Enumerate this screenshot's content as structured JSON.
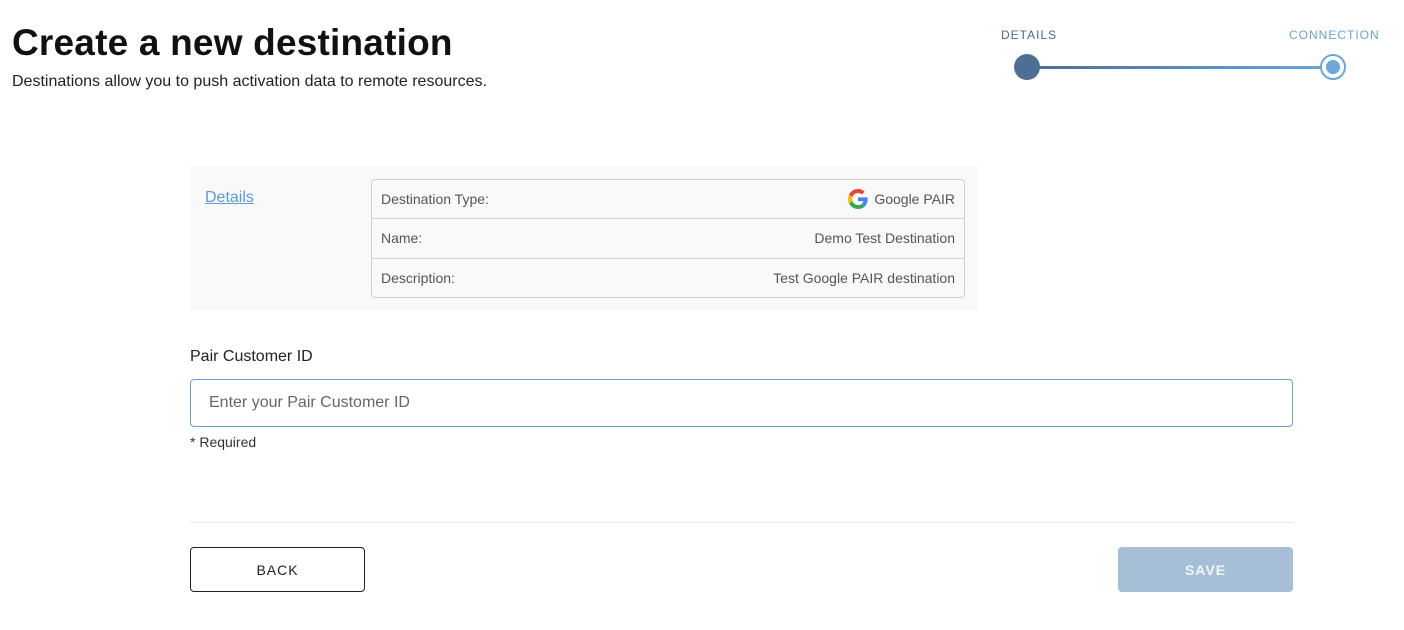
{
  "header": {
    "title": "Create a new destination",
    "subtitle": "Destinations allow you to push activation data to remote resources."
  },
  "stepper": {
    "steps": [
      {
        "label": "DETAILS",
        "state": "completed"
      },
      {
        "label": "CONNECTION",
        "state": "active"
      }
    ],
    "colors": {
      "completed": "#4d6f93",
      "active": "#6ba6dc"
    }
  },
  "summary": {
    "details_link": "Details",
    "rows": [
      {
        "label": "Destination Type:",
        "value": "Google PAIR",
        "icon": "google-icon"
      },
      {
        "label": "Name:",
        "value": "Demo Test Destination"
      },
      {
        "label": "Description:",
        "value": "Test Google PAIR destination"
      }
    ]
  },
  "form": {
    "pair_customer_id": {
      "label": "Pair Customer ID",
      "placeholder": "Enter your Pair Customer ID",
      "value": "",
      "note": "* Required"
    }
  },
  "actions": {
    "back_label": "BACK",
    "save_label": "SAVE",
    "save_disabled": true
  }
}
